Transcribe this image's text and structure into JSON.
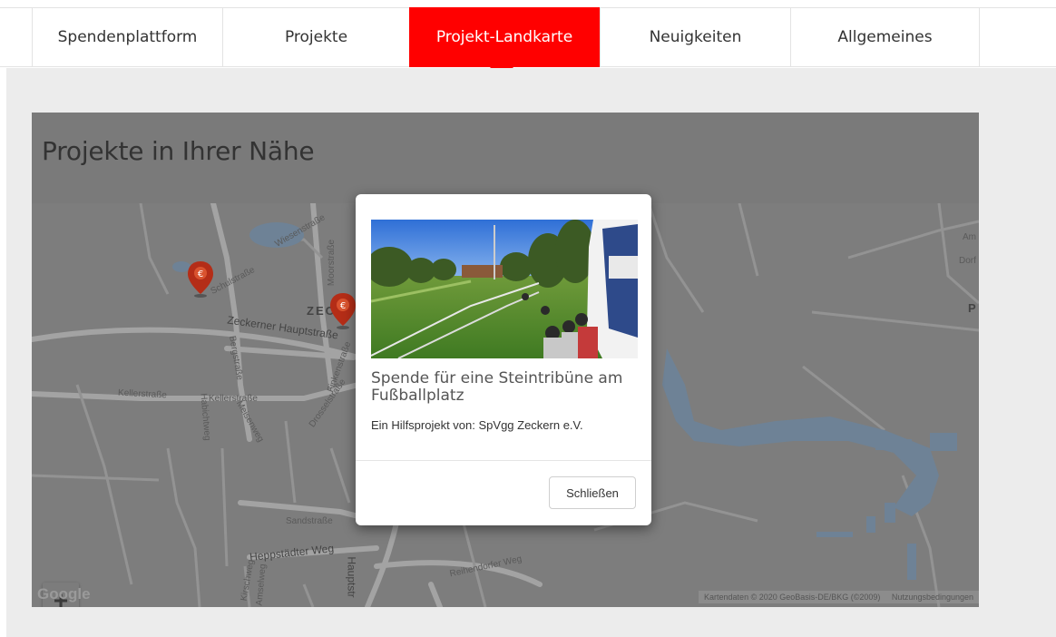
{
  "nav": {
    "items": [
      {
        "label": "Spendenplattform",
        "active": false
      },
      {
        "label": "Projekte",
        "active": false
      },
      {
        "label": "Projekt-Landkarte",
        "active": true
      },
      {
        "label": "Neuigkeiten",
        "active": false
      },
      {
        "label": "Allgemeines",
        "active": false
      }
    ],
    "accent_color": "#ff0000"
  },
  "map": {
    "heading": "Projekte in Ihrer Nähe",
    "streets": [
      "Zeckerner Hauptstraße",
      "Schulstraße",
      "Wiesenstraße",
      "Moorstraße",
      "Bergstraße",
      "Kellerstraße",
      "Kellerstraße",
      "Habichtweg",
      "Meisenweg",
      "Drosselstraße",
      "Finkenstraße",
      "Sandstraße",
      "Heppstädter Weg",
      "Reihendorfer Weg",
      "Hauptstr",
      "Kirschweg",
      "Amselweg"
    ],
    "place_label": "ZEC",
    "edge_labels": [
      "Am",
      "Dorf",
      "P"
    ],
    "zoom_in": "+",
    "zoom_out": "−",
    "logo": "Google",
    "attribution": "Kartendaten © 2020 GeoBasis-DE/BKG (©2009)",
    "terms": "Nutzungsbedingungen"
  },
  "modal": {
    "title": "Spende für eine Steintribüne am Fußballplatz",
    "subtitle": "Ein Hilfsprojekt von: SpVgg Zeckern e.V.",
    "close_label": "Schließen"
  }
}
